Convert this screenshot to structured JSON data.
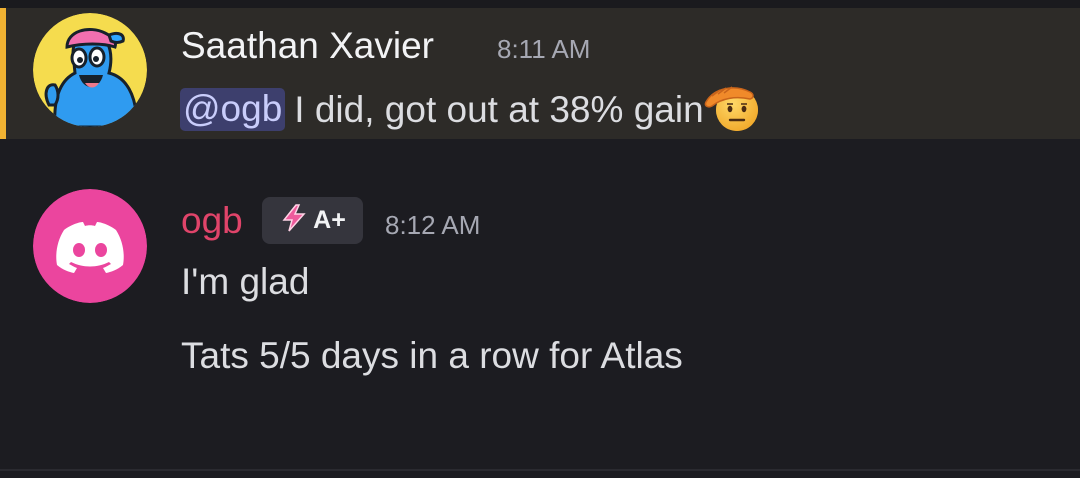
{
  "messages": [
    {
      "author": "Saathan Xavier",
      "timestamp": "8:11 AM",
      "mention": "@ogb",
      "text": "I did, got out at 38% gain",
      "avatar_icon": "cartoon-character-avatar",
      "emoji_icon": "saluting-face-emoji",
      "highlighted": true
    },
    {
      "author": "ogb",
      "badge_text": "A+",
      "badge_icon": "lightning-bolt-icon",
      "timestamp": "8:12 AM",
      "avatar_icon": "discord-logo-avatar",
      "lines": [
        "I'm glad",
        "Tats 5/5 days in a row for Atlas"
      ]
    }
  ],
  "colors": {
    "background": "#1c1c21",
    "highlight_background": "#2d2b28",
    "mention_bar": "#f0b232",
    "ogb_name": "#e0446a",
    "mention_background": "#3d3f6d",
    "discord_avatar_bg": "#eb459e"
  }
}
